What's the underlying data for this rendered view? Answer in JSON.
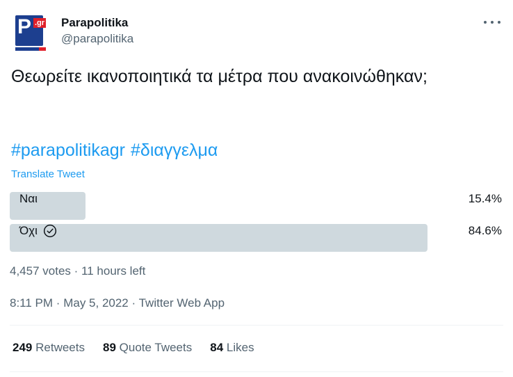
{
  "account": {
    "display_name": "Parapolitika",
    "handle": "@parapolitika",
    "avatar_icon": "parapolitika-logo",
    "avatar_text": "P.gr",
    "brand_colors": {
      "blue": "#1d3f8f",
      "red": "#e0202a"
    }
  },
  "tweet": {
    "text": "Θεωρείτε ικανοποιητικά τα μέτρα που ανακοινώθηκαν;",
    "hashtags": [
      "#parapolitikagr",
      "#διαγγελμα"
    ],
    "translate_label": "Translate Tweet"
  },
  "poll": {
    "options": [
      {
        "label": "Ναι",
        "percent_text": "15.4%",
        "percent": 15.4,
        "winner": false
      },
      {
        "label": "Όχι",
        "percent_text": "84.6%",
        "percent": 84.6,
        "winner": true,
        "winner_icon": "check-circle-icon"
      }
    ],
    "votes": "4,457 votes",
    "separator": "·",
    "time_left": "11 hours left",
    "bar_color": "#cfd9de"
  },
  "meta": {
    "time": "8:11 PM",
    "date": "May 5, 2022",
    "source": "Twitter Web App",
    "separator": "·"
  },
  "stats": {
    "retweets_count": "249",
    "retweets_label": "Retweets",
    "quotes_count": "89",
    "quotes_label": "Quote Tweets",
    "likes_count": "84",
    "likes_label": "Likes"
  },
  "colors": {
    "link": "#1d9bf0",
    "secondary_text": "#536471",
    "primary_text": "#0f1419"
  }
}
